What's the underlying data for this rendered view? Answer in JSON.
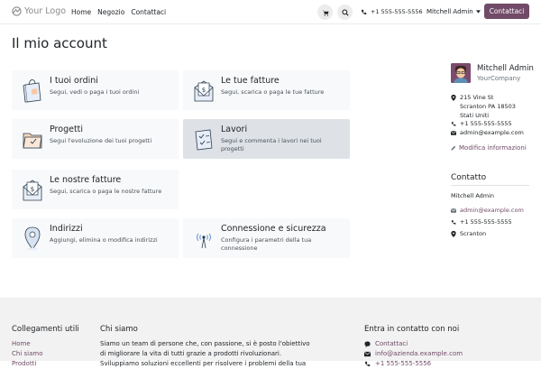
{
  "nav": {
    "logo": "Your Logo",
    "links": [
      "Home",
      "Negozio",
      "Contattaci"
    ],
    "phone": "+1 555-555-5556",
    "user": "Mitchell Admin",
    "contact_button": "Contattaci"
  },
  "page": {
    "title": "Il mio account"
  },
  "cards": [
    {
      "title": "I tuoi ordini",
      "desc": "Segui, vedi o paga i tuoi ordini",
      "icon": "shopping-bag-icon"
    },
    {
      "title": "Le tue fatture",
      "desc": "Segui, scarica o paga le tue fatture",
      "icon": "invoice-envelope-icon"
    },
    {
      "title": "Progetti",
      "desc": "Segui l'evoluzione dei tuoi progetti",
      "icon": "folder-icon"
    },
    {
      "title": "Lavori",
      "desc": "Segui e commenta i lavori nei tuoi progetti",
      "icon": "task-checklist-icon"
    },
    {
      "title": "Le nostre fatture",
      "desc": "Segui, scarica o paga le nostre fatture",
      "icon": "invoice-envelope-icon"
    },
    {
      "title": "Indirizzi",
      "desc": "Aggiungi, elimina o modifica indirizzi",
      "icon": "map-pin-icon"
    },
    {
      "title": "Connessione e sicurezza",
      "desc": "Configura i parametri della tua connessione",
      "icon": "antenna-icon"
    }
  ],
  "profile": {
    "name": "Mitchell Admin",
    "company": "YourCompany",
    "address": [
      "215 Vine St",
      "Scranton PA 18503",
      "Stati Uniti"
    ],
    "phone": "+1 555-555-5555",
    "email": "admin@example.com",
    "edit_label": "Modifica informazioni"
  },
  "contact": {
    "title": "Contatto",
    "name": "Mitchell Admin",
    "email": "admin@example.com",
    "phone": "+1 555-555-5555",
    "city": "Scranton"
  },
  "footer": {
    "links_title": "Collegamenti utili",
    "links": [
      "Home",
      "Chi siamo",
      "Prodotti"
    ],
    "about_title": "Chi siamo",
    "about_text": "Siamo un team di persone che, con passione, si è posto l'obiettivo di migliorare la vita di tutti grazie a prodotti rivoluzionari. Sviluppiamo soluzioni eccellenti per risolvere i problemi della tua",
    "contact_title": "Entra in contatto con noi",
    "contact_items": [
      "Contattaci",
      "info@azienda.example.com",
      "+1 555-555-5556"
    ]
  },
  "colors": {
    "brand": "#714b67",
    "card": "#f8f9fa",
    "card_active": "#dee2e6"
  }
}
